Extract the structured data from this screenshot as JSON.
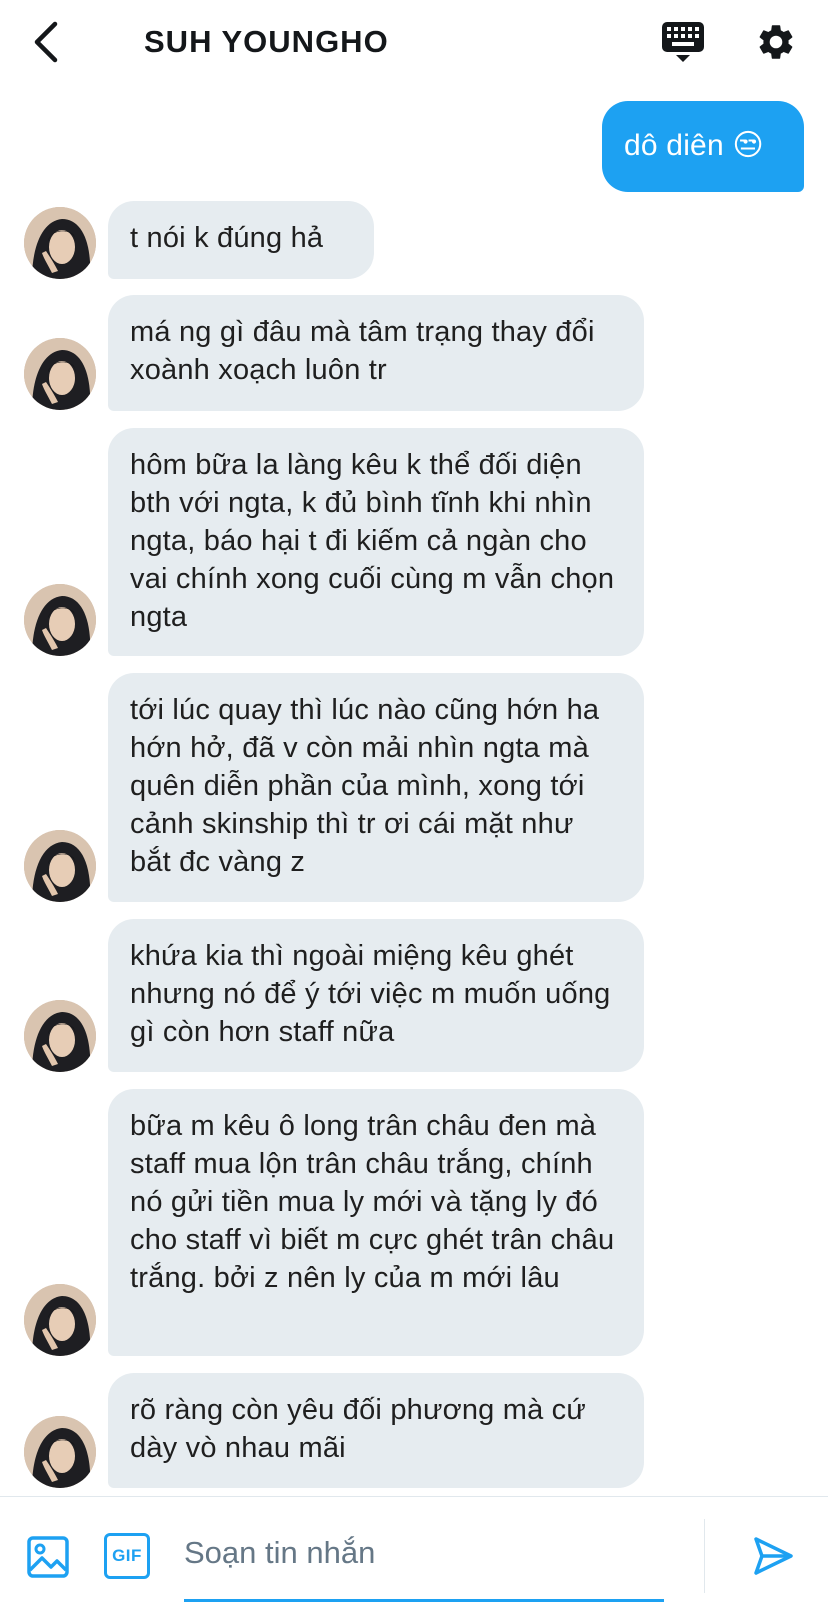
{
  "header": {
    "title": "SUH YOUNGHO"
  },
  "messages": [
    {
      "direction": "out",
      "text": "dô diên 😒"
    },
    {
      "direction": "in",
      "text": "t nói k đúng hả"
    },
    {
      "direction": "in",
      "text": "má ng gì đâu mà tâm trạng thay đổi xoành xoạch luôn tr"
    },
    {
      "direction": "in",
      "text": "hôm bữa la làng kêu k thể đối diện bth với ngta, k đủ bình tĩnh khi nhìn ngta, báo hại t đi kiếm cả ngàn cho vai chính xong cuối cùng m vẫn chọn ngta"
    },
    {
      "direction": "in",
      "text": "tới lúc quay thì lúc nào cũng hớn ha hớn hở, đã v còn mải nhìn ngta mà quên diễn phần của mình, xong tới cảnh skinship thì tr ơi cái mặt như bắt đc vàng z"
    },
    {
      "direction": "in",
      "text": "khứa kia thì ngoài miệng kêu ghét nhưng nó để ý tới việc m muốn uống gì còn hơn staff nữa"
    },
    {
      "direction": "in",
      "text": "bữa m kêu ô long trân châu đen mà staff mua lộn trân châu trắng, chính nó gửi tiền mua ly mới và tặng ly đó cho staff vì biết m cực ghét trân châu trắng. bởi z nên ly của m mới lâu"
    },
    {
      "direction": "in",
      "text": "rõ ràng còn yêu đối phương mà cứ dày vò nhau mãi"
    }
  ],
  "composer": {
    "placeholder": "Soạn tin nhắn",
    "gif_label": "GIF"
  },
  "colors": {
    "accent": "#1da1f2",
    "incoming_bubble": "#e6ecf0",
    "text": "#14171a",
    "placeholder": "#657786"
  },
  "icons": {
    "back": "chevron-left-icon",
    "keyboard": "keyboard-icon",
    "settings": "gear-icon",
    "image": "image-icon",
    "gif": "gif-icon",
    "send": "send-icon"
  }
}
